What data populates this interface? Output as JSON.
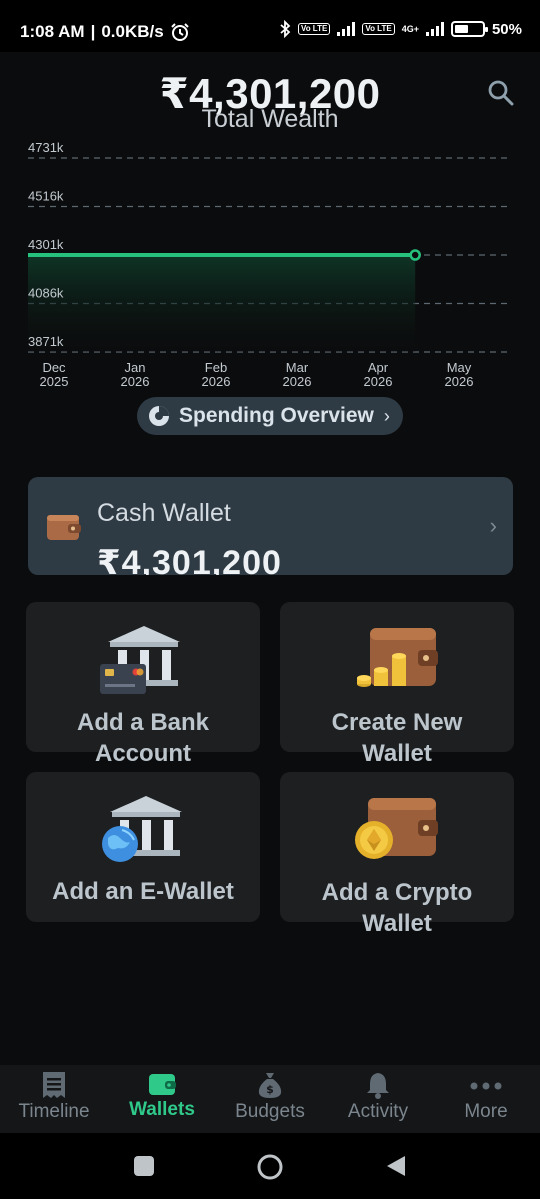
{
  "status_bar": {
    "time": "1:08 AM",
    "net_speed": "0.0KB/s",
    "lte1": "Vo LTE",
    "lte2": "Vo LTE",
    "net_type": "4G+",
    "battery": "50%",
    "battery_level": 0.5
  },
  "header": {
    "total_amount": "₹4,301,200",
    "total_label": "Total Wealth"
  },
  "chart_data": {
    "type": "line",
    "x": [
      "Dec 2025",
      "Jan 2026",
      "Feb 2026",
      "Mar 2026",
      "Apr 2026",
      "May 2026"
    ],
    "x_ticks": [
      [
        "Dec",
        "2025"
      ],
      [
        "Jan",
        "2026"
      ],
      [
        "Feb",
        "2026"
      ],
      [
        "Mar",
        "2026"
      ],
      [
        "Apr",
        "2026"
      ],
      [
        "May",
        "2026"
      ]
    ],
    "y_ticks": [
      "4731k",
      "4516k",
      "4301k",
      "4086k",
      "3871k"
    ],
    "y_tick_values": [
      4731,
      4516,
      4301,
      4086,
      3871
    ],
    "ylim": [
      3871,
      4731
    ],
    "series": [
      {
        "values": [
          4301,
          4301,
          4301,
          4301,
          4301,
          4301
        ],
        "end_fraction_of_axis": 0.8
      }
    ],
    "line_color": "#27c17e",
    "grid": "dashed horizontal"
  },
  "spending_overview": {
    "label": "Spending Overview"
  },
  "cash_wallet": {
    "name": "Cash Wallet",
    "amount": "₹4,301,200"
  },
  "tiles": [
    {
      "label_lines": [
        "Add a Bank",
        "Account"
      ]
    },
    {
      "label_lines": [
        "Create New",
        "Wallet"
      ]
    },
    {
      "label_lines": [
        "Add an E-Wallet"
      ]
    },
    {
      "label_lines": [
        "Add a Crypto",
        "Wallet"
      ]
    }
  ],
  "bottom_nav": {
    "items": [
      {
        "label": "Timeline",
        "icon": "receipt-icon",
        "active": false
      },
      {
        "label": "Wallets",
        "icon": "wallet-icon",
        "active": true
      },
      {
        "label": "Budgets",
        "icon": "money-bag-icon",
        "active": false
      },
      {
        "label": "Activity",
        "icon": "bell-icon",
        "active": false
      },
      {
        "label": "More",
        "icon": "more-dots-icon",
        "active": false
      }
    ]
  },
  "colors": {
    "accent": "#2fc98a",
    "card": "#2f3b44",
    "tile": "#1d1f21",
    "background": "#0b0c0d"
  }
}
